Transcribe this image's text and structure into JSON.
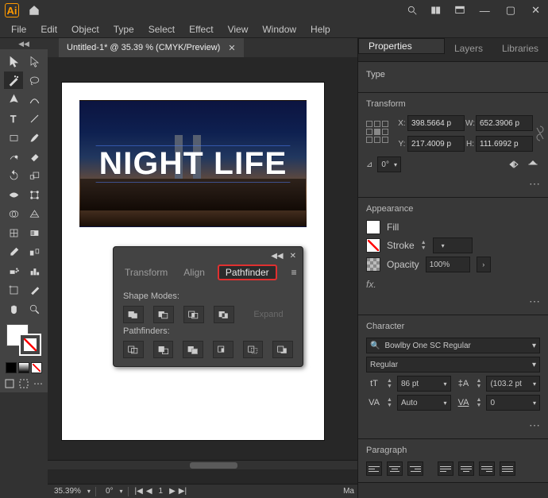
{
  "menubar": {
    "items": [
      "File",
      "Edit",
      "Object",
      "Type",
      "Select",
      "Effect",
      "View",
      "Window",
      "Help"
    ]
  },
  "doctab": {
    "title": "Untitled-1* @ 35.39 % (CMYK/Preview)"
  },
  "canvas_text": "NIGHT LIFE",
  "pathfinder": {
    "tabs": {
      "transform": "Transform",
      "align": "Align",
      "pathfinder": "Pathfinder"
    },
    "shape_modes_label": "Shape Modes:",
    "pathfinders_label": "Pathfinders:",
    "expand": "Expand"
  },
  "statusbar": {
    "zoom": "35.39%",
    "rotation": "0°",
    "marker": "Ma"
  },
  "right": {
    "tabs": {
      "properties": "Properties",
      "layers": "Layers",
      "libraries": "Libraries"
    },
    "type_label": "Type",
    "transform": {
      "title": "Transform",
      "x_label": "X:",
      "x": "398.5664 p",
      "y_label": "Y:",
      "y": "217.4009 p",
      "w_label": "W:",
      "w": "652.3906 p",
      "h_label": "H:",
      "h": "111.6992 p",
      "rotation": "0°"
    },
    "appearance": {
      "title": "Appearance",
      "fill_label": "Fill",
      "stroke_label": "Stroke",
      "opacity_label": "Opacity",
      "opacity": "100%",
      "fx": "fx."
    },
    "character": {
      "title": "Character",
      "font": "Bowlby One SC Regular",
      "style": "Regular",
      "size": "86 pt",
      "leading": "(103.2 pt",
      "kerning": "Auto",
      "tracking": "0"
    },
    "paragraph": {
      "title": "Paragraph"
    }
  }
}
